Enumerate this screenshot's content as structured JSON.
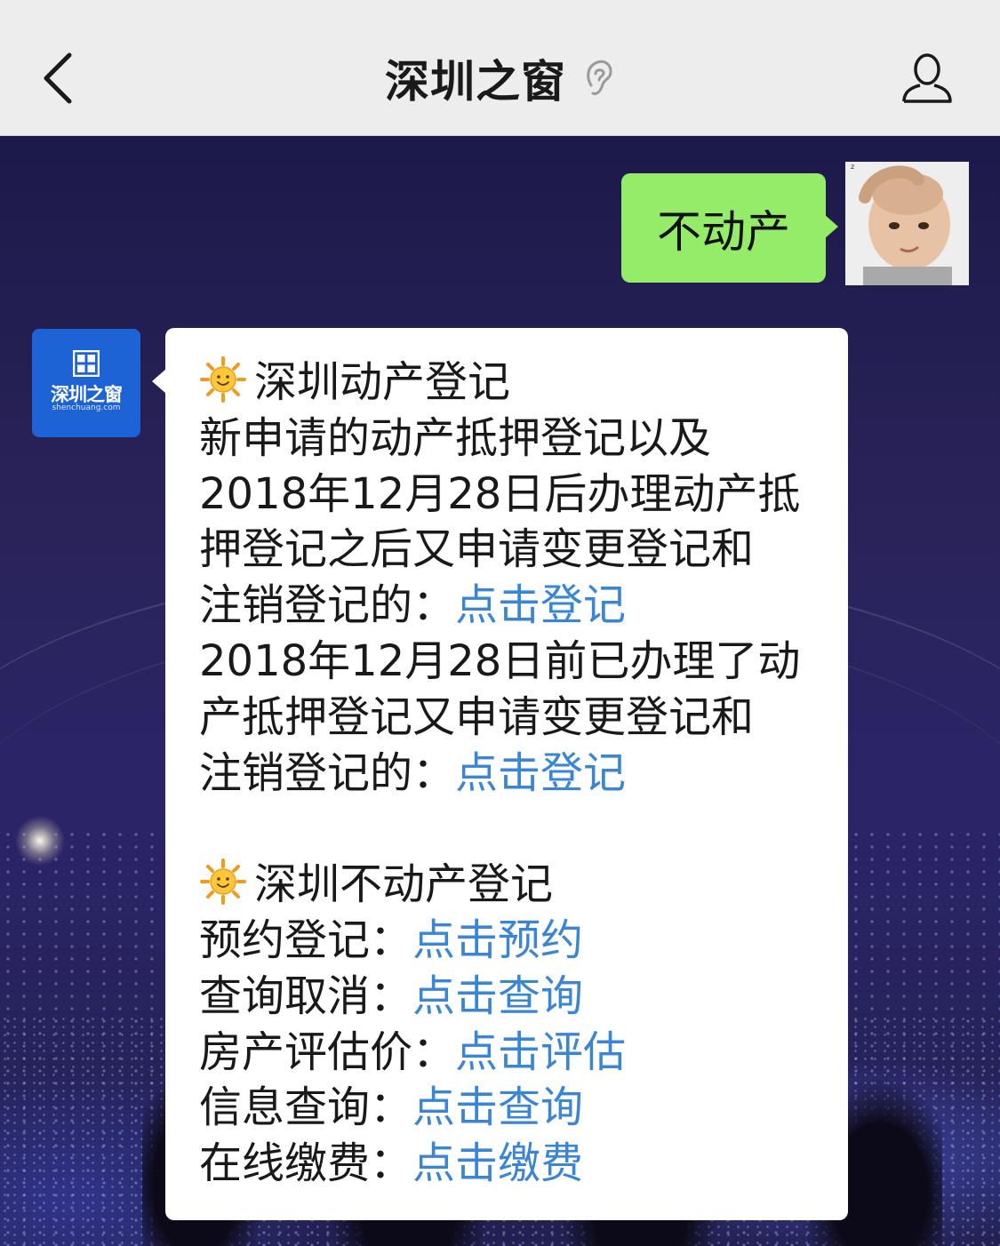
{
  "header": {
    "title": "深圳之窗",
    "back_icon": "chevron-left-icon",
    "ear_icon": "ear-icon",
    "profile_icon": "person-icon"
  },
  "sent_message": {
    "text": "不动产"
  },
  "bot_avatar": {
    "logo_text": "深圳之窗",
    "logo_sub": "shenchuang.com",
    "color": "#1e63d6"
  },
  "reply": {
    "section1": {
      "title": "深圳动产登记",
      "lines": [
        "新申请的动产抵押登记以及",
        "2018年12月28日后办理动产抵",
        "押登记之后又申请变更登记和"
      ],
      "line4_prefix": "注销登记的：",
      "link1": "点击登记",
      "lines2": [
        "2018年12月28日前已办理了动",
        "产抵押登记又申请变更登记和"
      ],
      "line7_prefix": "注销登记的：",
      "link2": "点击登记"
    },
    "section2": {
      "title": "深圳不动产登记",
      "items": [
        {
          "label": "预约登记：",
          "link": "点击预约"
        },
        {
          "label": "查询取消：",
          "link": "点击查询"
        },
        {
          "label": "房产评估价：",
          "link": "点击评估"
        },
        {
          "label": "信息查询：",
          "link": "点击查询"
        },
        {
          "label": "在线缴费：",
          "link": "点击缴费"
        }
      ]
    },
    "link_color": "#3a86d4"
  },
  "colors": {
    "sent_bubble": "#95ec69",
    "header_bg": "#ededed"
  }
}
